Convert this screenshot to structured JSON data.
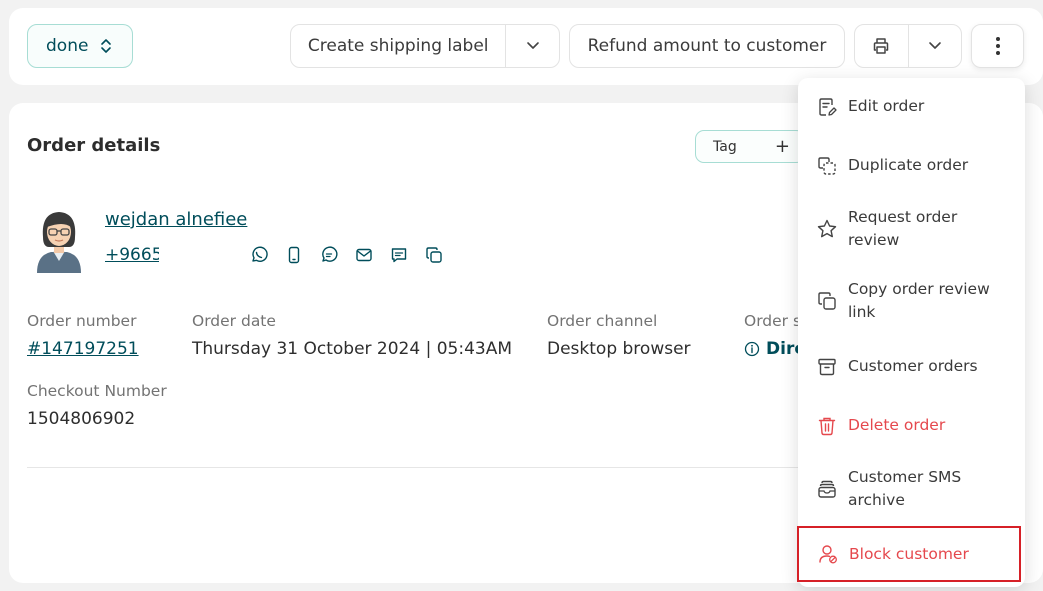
{
  "topbar": {
    "status_value": "done",
    "create_shipping_label": "Create shipping label",
    "refund_label": "Refund amount to customer"
  },
  "card": {
    "title": "Order details",
    "tag_label": "Tag",
    "tag_add": "+",
    "customer_name": "wejdan alnefiee",
    "customer_phone": "+9665",
    "fields": {
      "order_number_label": "Order number",
      "order_number_value": "#147197251",
      "order_date_label": "Order date",
      "order_date_value": "Thursday 31 October 2024 | 05:43AM",
      "order_channel_label": "Order channel",
      "order_channel_value": "Desktop browser",
      "order_source_label": "Order s",
      "order_source_value": "Dire",
      "checkout_number_label": "Checkout Number",
      "checkout_number_value": "1504806902"
    }
  },
  "menu": {
    "items": [
      {
        "label": "Edit order",
        "icon": "edit-order-icon"
      },
      {
        "label": "Duplicate order",
        "icon": "duplicate-icon"
      },
      {
        "label": "Request order review",
        "icon": "star-icon"
      },
      {
        "label": "Copy order review link",
        "icon": "copy-icon"
      },
      {
        "label": "Customer orders",
        "icon": "archive-box-icon"
      },
      {
        "label": "Delete order",
        "icon": "trash-icon"
      },
      {
        "label": "Customer SMS archive",
        "icon": "inbox-icon"
      },
      {
        "label": "Block customer",
        "icon": "user-block-icon"
      }
    ]
  },
  "colors": {
    "brand": "#004d5a",
    "accent_border": "#a7ddd4",
    "danger": "#e5484d",
    "highlight_box": "#d62027"
  }
}
